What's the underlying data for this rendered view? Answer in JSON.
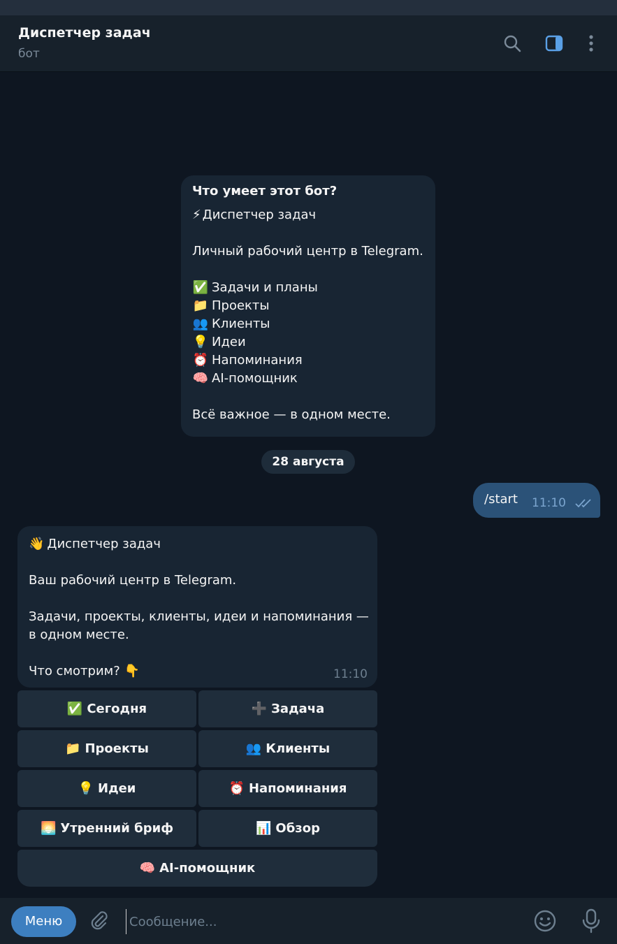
{
  "header": {
    "title": "Диспетчер задач",
    "subtitle": "бот",
    "icons": [
      "search-icon",
      "sidebar-toggle-icon",
      "more-vertical-icon"
    ],
    "accent": "#5aa0e6"
  },
  "intro": {
    "title": "Что умеет этот бот?",
    "line1": "⚡",
    "line1_text": "Диспетчер задач",
    "line2": "Личный рабочий центр в Telegram.",
    "features": [
      {
        "emoji": "✅",
        "label": "Задачи и планы"
      },
      {
        "emoji": "📁",
        "label": "Проекты"
      },
      {
        "emoji": "👥",
        "label": "Клиенты"
      },
      {
        "emoji": "💡",
        "label": "Идеи"
      },
      {
        "emoji": "⏰",
        "label": "Напоминания"
      },
      {
        "emoji": "🧠",
        "label": "AI-помощник"
      }
    ],
    "footer": "Всё важное — в одном месте."
  },
  "date_pill": "28 августа",
  "outgoing": {
    "text": "/start",
    "time": "11:10"
  },
  "bot_message": {
    "emoji": "👋",
    "title": "Диспетчер задач",
    "line1": "Ваш рабочий центр в Telegram.",
    "line2a": "Задачи, проекты, клиенты, идеи и напоминания —",
    "line2b": "в одном месте.",
    "question": "Что смотрим?",
    "question_emoji": "👇",
    "time": "11:10"
  },
  "keyboard": {
    "today": {
      "emoji": "✅",
      "label": "Сегодня"
    },
    "task": {
      "emoji": "➕",
      "label": "Задача"
    },
    "projects": {
      "emoji": "📁",
      "label": "Проекты"
    },
    "clients": {
      "emoji": "👥",
      "label": "Клиенты"
    },
    "ideas": {
      "emoji": "💡",
      "label": "Идеи"
    },
    "reminders": {
      "emoji": "⏰",
      "label": "Напоминания"
    },
    "brief": {
      "emoji": "🌅",
      "label": "Утренний бриф"
    },
    "overview": {
      "emoji": "📊",
      "label": "Обзор"
    },
    "ai": {
      "emoji": "🧠",
      "label": "AI-помощник"
    }
  },
  "composer": {
    "menu_label": "Меню",
    "placeholder": "Сообщение...",
    "value": ""
  }
}
